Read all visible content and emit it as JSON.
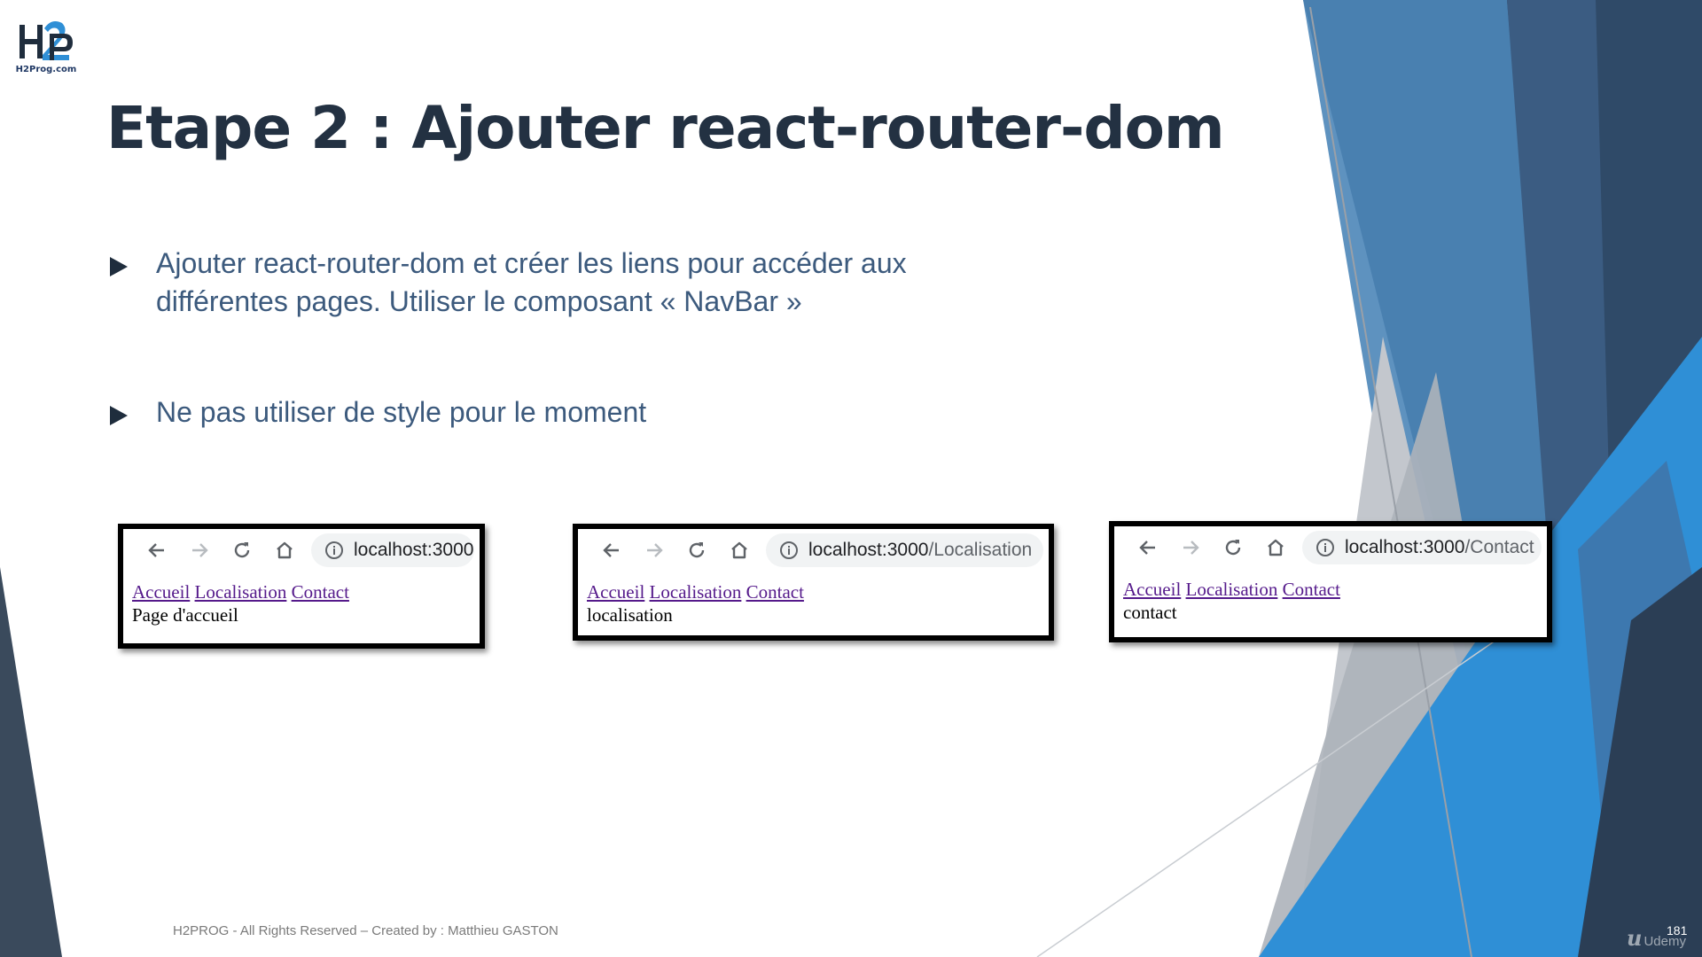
{
  "logo": {
    "caption": "H2Prog.com"
  },
  "slide": {
    "title": "Etape 2 : Ajouter react-router-dom",
    "bullets": [
      {
        "lines": [
          "Ajouter react-router-dom et créer les liens pour accéder aux",
          "différentes pages. Utiliser le composant « NavBar »"
        ]
      },
      {
        "lines": [
          "Ne pas utiliser de style pour le moment"
        ]
      }
    ],
    "footer": "H2PROG - All Rights Reserved – Created by : Matthieu GASTON",
    "slide_number": "181",
    "watermark": "Udemy"
  },
  "screenshots": [
    {
      "url_host": "localhost:3000",
      "url_path": "",
      "links": [
        "Accueil",
        "Localisation",
        "Contact"
      ],
      "content": "Page d'accueil"
    },
    {
      "url_host": "localhost:3000",
      "url_path": "/Localisation",
      "links": [
        "Accueil",
        "Localisation",
        "Contact"
      ],
      "content": "localisation"
    },
    {
      "url_host": "localhost:3000",
      "url_path": "/Contact",
      "links": [
        "Accueil",
        "Localisation",
        "Contact"
      ],
      "content": "contact"
    }
  ],
  "icons": {
    "back": "arrow-left-icon",
    "forward": "arrow-right-icon",
    "reload": "reload-icon",
    "home": "home-icon",
    "info": "info-icon"
  },
  "colors": {
    "title": "#233142",
    "bullet_text": "#3c5a7d",
    "link": "#551a8b",
    "accent_blue": "#2e86c9",
    "dark_navy": "#2c3e50"
  }
}
